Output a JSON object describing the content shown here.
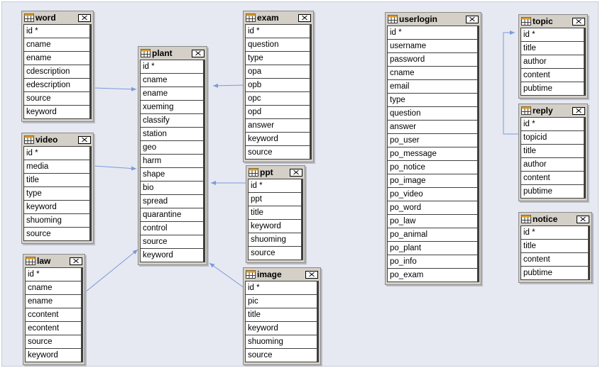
{
  "diagram": {
    "tables": {
      "word": {
        "name": "word",
        "columns": [
          "id *",
          "cname",
          "ename",
          "cdescription",
          "edescription",
          "source",
          "keyword"
        ]
      },
      "video": {
        "name": "video",
        "columns": [
          "id *",
          "media",
          "title",
          "type",
          "keyword",
          "shuoming",
          "source"
        ]
      },
      "law": {
        "name": "law",
        "columns": [
          "id *",
          "cname",
          "ename",
          "ccontent",
          "econtent",
          "source",
          "keyword"
        ]
      },
      "plant": {
        "name": "plant",
        "columns": [
          "id *",
          "cname",
          "ename",
          "xueming",
          "classify",
          "station",
          "geo",
          "harm",
          "shape",
          "bio",
          "spread",
          "quarantine",
          "control",
          "source",
          "keyword"
        ]
      },
      "exam": {
        "name": "exam",
        "columns": [
          "id *",
          "question",
          "type",
          "opa",
          "opb",
          "opc",
          "opd",
          "answer",
          "keyword",
          "source"
        ]
      },
      "ppt": {
        "name": "ppt",
        "columns": [
          "id *",
          "ppt",
          "title",
          "keyword",
          "shuoming",
          "source"
        ]
      },
      "image": {
        "name": "image",
        "columns": [
          "id *",
          "pic",
          "title",
          "keyword",
          "shuoming",
          "source"
        ]
      },
      "userlogin": {
        "name": "userlogin",
        "columns": [
          "id *",
          "username",
          "password",
          "cname",
          "email",
          "type",
          "question",
          "answer",
          "po_user",
          "po_message",
          "po_notice",
          "po_image",
          "po_video",
          "po_word",
          "po_law",
          "po_animal",
          "po_plant",
          "po_info",
          "po_exam"
        ]
      },
      "topic": {
        "name": "topic",
        "columns": [
          "id *",
          "title",
          "author",
          "content",
          "pubtime"
        ]
      },
      "reply": {
        "name": "reply",
        "columns": [
          "id *",
          "topicid",
          "title",
          "author",
          "content",
          "pubtime"
        ]
      },
      "notice": {
        "name": "notice",
        "columns": [
          "id *",
          "title",
          "content",
          "pubtime"
        ]
      }
    },
    "relationships": [
      {
        "from": "word",
        "to": "plant"
      },
      {
        "from": "video",
        "to": "plant"
      },
      {
        "from": "law",
        "to": "plant"
      },
      {
        "from": "exam",
        "to": "plant"
      },
      {
        "from": "ppt",
        "to": "plant"
      },
      {
        "from": "image",
        "to": "plant"
      },
      {
        "from": "reply",
        "to": "topic"
      }
    ],
    "colors": {
      "canvas": "#e6e9f2",
      "connector": "#7a9ad8",
      "table_frame": "#d4d0c8"
    }
  }
}
